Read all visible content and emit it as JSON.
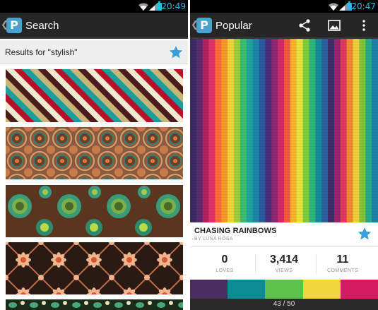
{
  "left_screen": {
    "status": {
      "time": "20:49"
    },
    "actionbar": {
      "title": "Search"
    },
    "results": {
      "text": "Results for \"stylish\""
    },
    "patterns": [
      {
        "name": "diagonal stripes pattern"
      },
      {
        "name": "brown geometric circles pattern"
      },
      {
        "name": "green retro flowers pattern"
      },
      {
        "name": "peach flowers lattice pattern"
      },
      {
        "name": "paisley pattern"
      }
    ]
  },
  "right_screen": {
    "status": {
      "time": "20:47"
    },
    "actionbar": {
      "title": "Popular",
      "icons": [
        "share-icon",
        "image-icon",
        "overflow-menu-icon"
      ]
    },
    "pattern": {
      "title": "CHASING RAINBOWS",
      "author": "BY LUNA ROSA"
    },
    "stats": [
      {
        "value": "0",
        "label": "LOVES"
      },
      {
        "value": "3,414",
        "label": "VIEWS"
      },
      {
        "value": "11",
        "label": "COMMENTS"
      }
    ],
    "palette": [
      "#4a2d5c",
      "#0e8a94",
      "#5cc34a",
      "#f2d43c",
      "#d81b60"
    ],
    "page_indicator": "43 / 50"
  },
  "colors": {
    "accent": "#33b5e5",
    "star": "#3a9fd8",
    "actionbar": "#262626",
    "status_bar": "#000000",
    "stripes": [
      "#f2ead0",
      "#b5122a",
      "#1a9e9e",
      "#c9b47a",
      "#4a1c1c"
    ],
    "rainbow": [
      "#3c2a63",
      "#5a2b6e",
      "#b3245d",
      "#e0336b",
      "#ff6a3d",
      "#f59a2a",
      "#f2d23a",
      "#9ccf3a",
      "#3cbf6a",
      "#1fa39c",
      "#1c86a8",
      "#2b5aa3",
      "#4a2f78",
      "#8a2a70",
      "#d42a6a",
      "#ee5a3a",
      "#f5b32a",
      "#e9e03a",
      "#7fcb3a",
      "#2fb77a",
      "#168a9a",
      "#2a5fa0",
      "#3d2c6a",
      "#9b246a",
      "#e03a63",
      "#f08a2a",
      "#f2cd3a",
      "#80c53a",
      "#26a98a",
      "#1b7fa8"
    ]
  }
}
